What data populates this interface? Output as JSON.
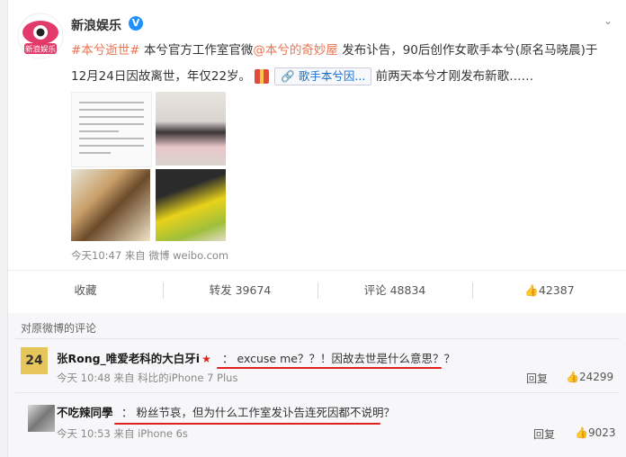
{
  "post": {
    "author": "新浪娱乐",
    "verified_badge": "V",
    "text_hashtag": "#本兮逝世#",
    "text_part1": " 本兮官方工作室官微",
    "text_mention": "@本兮的奇妙屋",
    "text_part2": " 发布讣告，90后创作女歌手本兮(原名马晓晨)于",
    "text_line2": "12月24日因故离世，年仅22岁。",
    "chip_label": "歌手本兮因...",
    "text_tail": " 前两天本兮才刚发布新歌……",
    "meta": "今天10:47 来自 微博 weibo.com"
  },
  "actions": {
    "favorite": "收藏",
    "repost": "转发 39674",
    "comment": "评论 48834",
    "like": "42387"
  },
  "comments_section": {
    "title": "对原微博的评论",
    "comments": [
      {
        "avatar_text": "24",
        "user": "张Rong_唯爱老科的大白牙i",
        "text": "：  excuse me？？！因故去世是什么意思？？",
        "meta": "今天 10:48 来自 科比的iPhone 7 Plus",
        "reply": "回复",
        "likes": "24299"
      },
      {
        "user": "不吃辣同學",
        "text": "：  粉丝节哀，但为什么工作室发讣告连死因都不说明？",
        "meta": "今天 10:53 来自 iPhone 6s",
        "reply": "回复",
        "likes": "9023"
      }
    ]
  },
  "icons": {
    "chevron": "chevron-down-icon",
    "like": "thumbs-up-icon",
    "badge": "star-badge-icon"
  },
  "colors": {
    "link": "#eb7350",
    "blue_link": "#1a6fc9",
    "underline": "#e0201c"
  }
}
